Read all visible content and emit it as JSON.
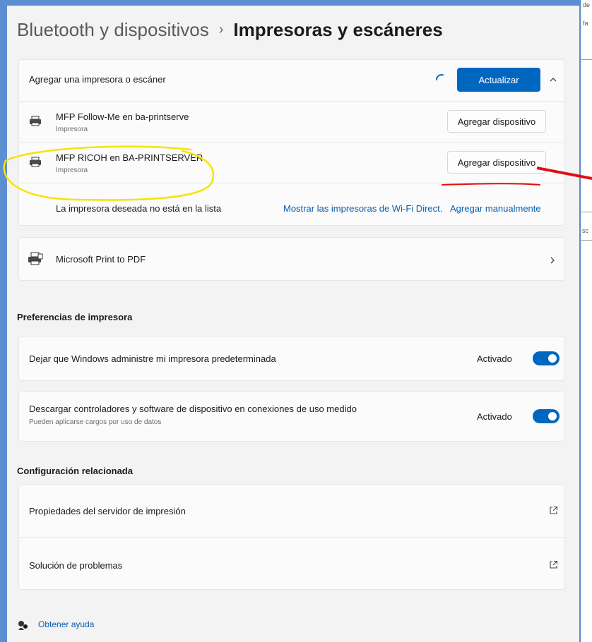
{
  "breadcrumb": {
    "parent": "Bluetooth y dispositivos",
    "separator": "›",
    "current": "Impresoras y escáneres"
  },
  "add_section": {
    "title": "Agregar una impresora o escáner",
    "refresh_label": "Actualizar",
    "devices": [
      {
        "name": "MFP Follow-Me en ba-printserve",
        "type": "Impresora",
        "action": "Agregar dispositivo"
      },
      {
        "name": "MFP RICOH en BA-PRINTSERVER",
        "type": "Impresora",
        "action": "Agregar dispositivo"
      }
    ],
    "not_listed": "La impresora deseada no está en la lista",
    "wifi_direct_link": "Mostrar las impresoras de Wi-Fi Direct.",
    "manual_link": "Agregar manualmente"
  },
  "printers": [
    {
      "name": "Microsoft Print to PDF"
    }
  ],
  "preferences": {
    "title": "Preferencias de impresora",
    "items": [
      {
        "label": "Dejar que Windows administre mi impresora predeterminada",
        "sublabel": "",
        "state": "Activado",
        "on": true
      },
      {
        "label": "Descargar controladores y software de dispositivo en conexiones de uso medido",
        "sublabel": "Pueden aplicarse cargos por uso de datos",
        "state": "Activado",
        "on": true
      }
    ]
  },
  "related": {
    "title": "Configuración relacionada",
    "items": [
      {
        "label": "Propiedades del servidor de impresión"
      },
      {
        "label": "Solución de problemas"
      }
    ]
  },
  "help": {
    "label": "Obtener ayuda"
  },
  "background_fragments": [
    "de",
    "fa",
    "sc"
  ],
  "colors": {
    "accent": "#0067c0",
    "annotation_highlight": "#f5e400",
    "annotation_arrow": "#e01010"
  }
}
